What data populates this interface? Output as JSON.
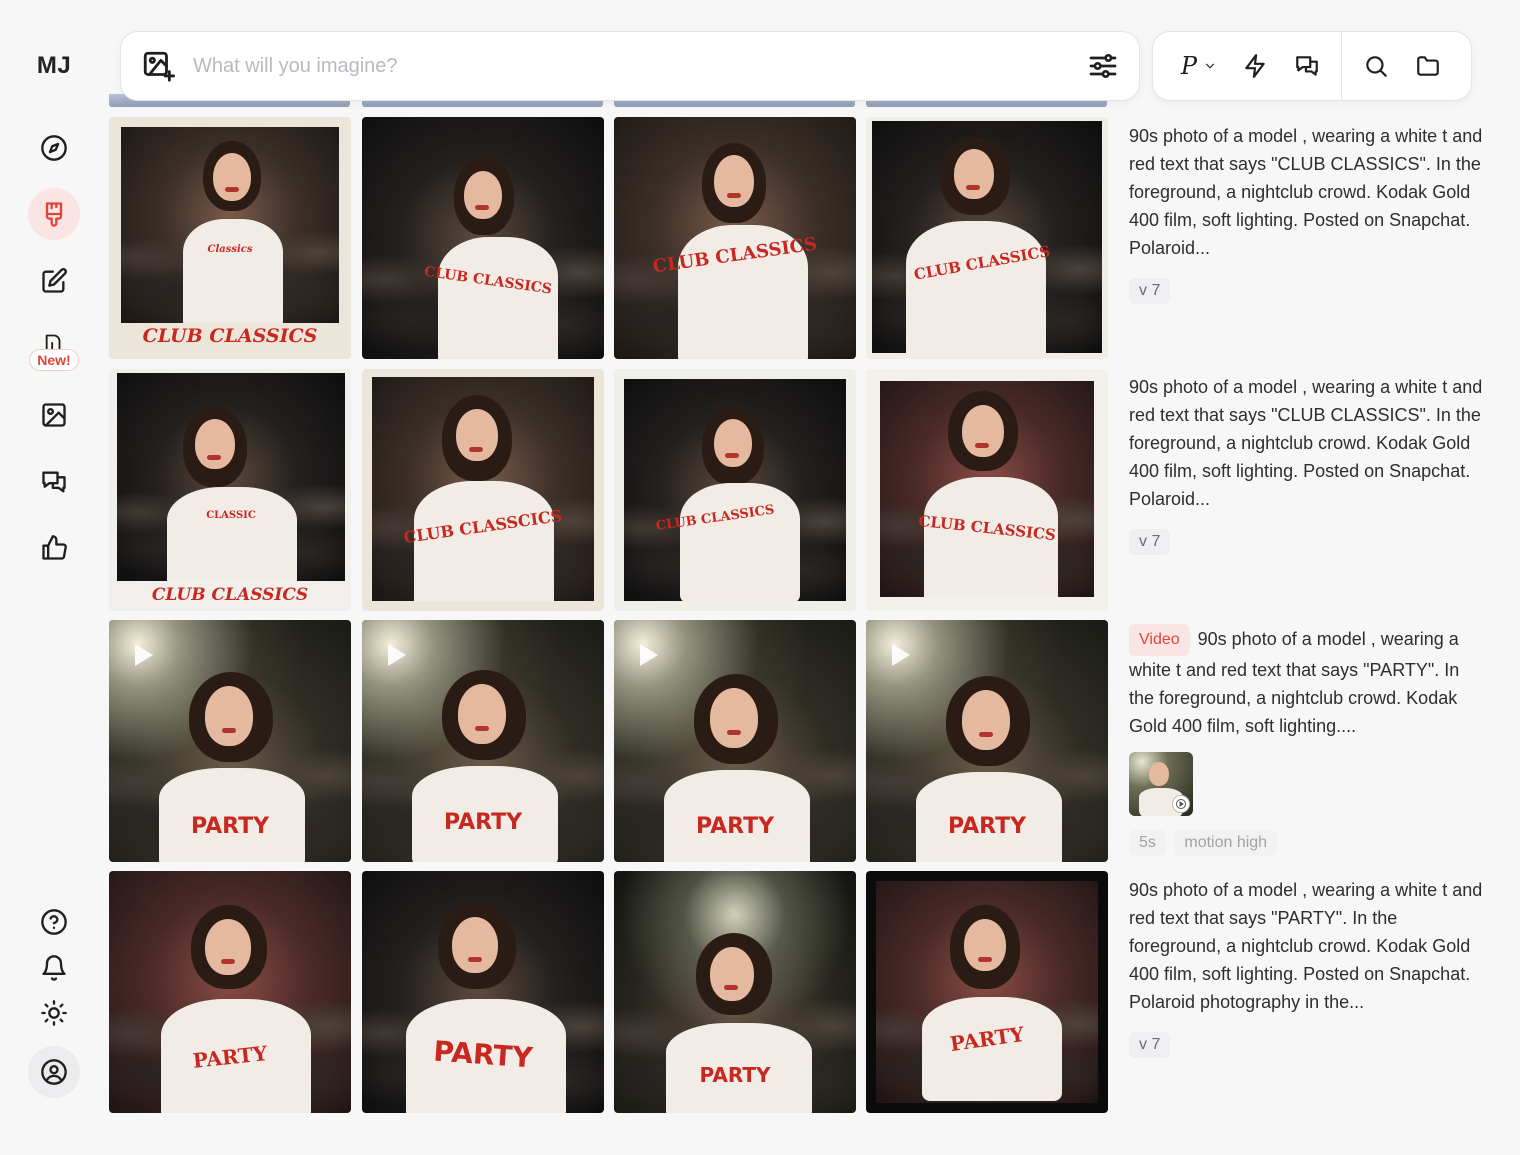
{
  "app": {
    "logo": "MJ"
  },
  "sidebar": {
    "items": [
      {
        "name": "explore",
        "icon": "compass-icon"
      },
      {
        "name": "create",
        "icon": "brush-icon",
        "active": true
      },
      {
        "name": "edit",
        "icon": "edit-icon"
      },
      {
        "name": "new-feature",
        "icon": "new-feature-icon",
        "badge": "New!"
      },
      {
        "name": "organize",
        "icon": "image-icon"
      },
      {
        "name": "chat",
        "icon": "chat-icon"
      },
      {
        "name": "rank",
        "icon": "thumbs-up-icon"
      }
    ],
    "bottom": [
      {
        "name": "help",
        "icon": "help-icon"
      },
      {
        "name": "notifications",
        "icon": "bell-icon"
      },
      {
        "name": "theme",
        "icon": "sun-icon"
      },
      {
        "name": "account",
        "icon": "user-icon"
      }
    ]
  },
  "search": {
    "placeholder": "What will you imagine?"
  },
  "toolbar": {
    "personalize_label": "P"
  },
  "rows": [
    {
      "prompt": "90s photo of a model , wearing a white t and red text that says \"CLUB CLASSICS\". In the foreground, a nightclub crowd. Kodak Gold 400 film, soft lighting. Posted on Snapchat. Polaroid...",
      "version": "v 7",
      "shirt_text": [
        "Classics",
        "CLUB CLASSICS",
        "CLUB CLASSICS",
        "CLUB CLASSICS"
      ],
      "caption": "CLUB CLASSICS"
    },
    {
      "prompt": "90s photo of a model , wearing a white t and red text that says \"CLUB CLASSICS\". In the foreground, a nightclub crowd. Kodak Gold 400 film, soft lighting. Posted on Snapchat. Polaroid...",
      "version": "v 7",
      "shirt_text": [
        "CLASSIC",
        "CLUB CLASSCICS",
        "CLUB CLASSICS",
        "CLUB CLASSICS"
      ],
      "caption": "CLUB CLASSICS"
    },
    {
      "badge": "Video",
      "prompt": "90s photo of a model , wearing a white t and red text that says \"PARTY\". In the foreground, a nightclub crowd. Kodak Gold 400 film, soft lighting....",
      "chips": [
        "5s",
        "motion high"
      ],
      "shirt_text": [
        "PARTY",
        "PARTY",
        "PARTY",
        "PARTY"
      ]
    },
    {
      "prompt": "90s photo of a model , wearing a white t and red text that says \"PARTY\". In the foreground, a nightclub crowd. Kodak Gold 400 film, soft lighting. Posted on Snapchat. Polaroid photography in the...",
      "version": "v 7",
      "shirt_text": [
        "PARTY",
        "PARTY",
        "PARTY",
        "PARTY"
      ]
    }
  ]
}
